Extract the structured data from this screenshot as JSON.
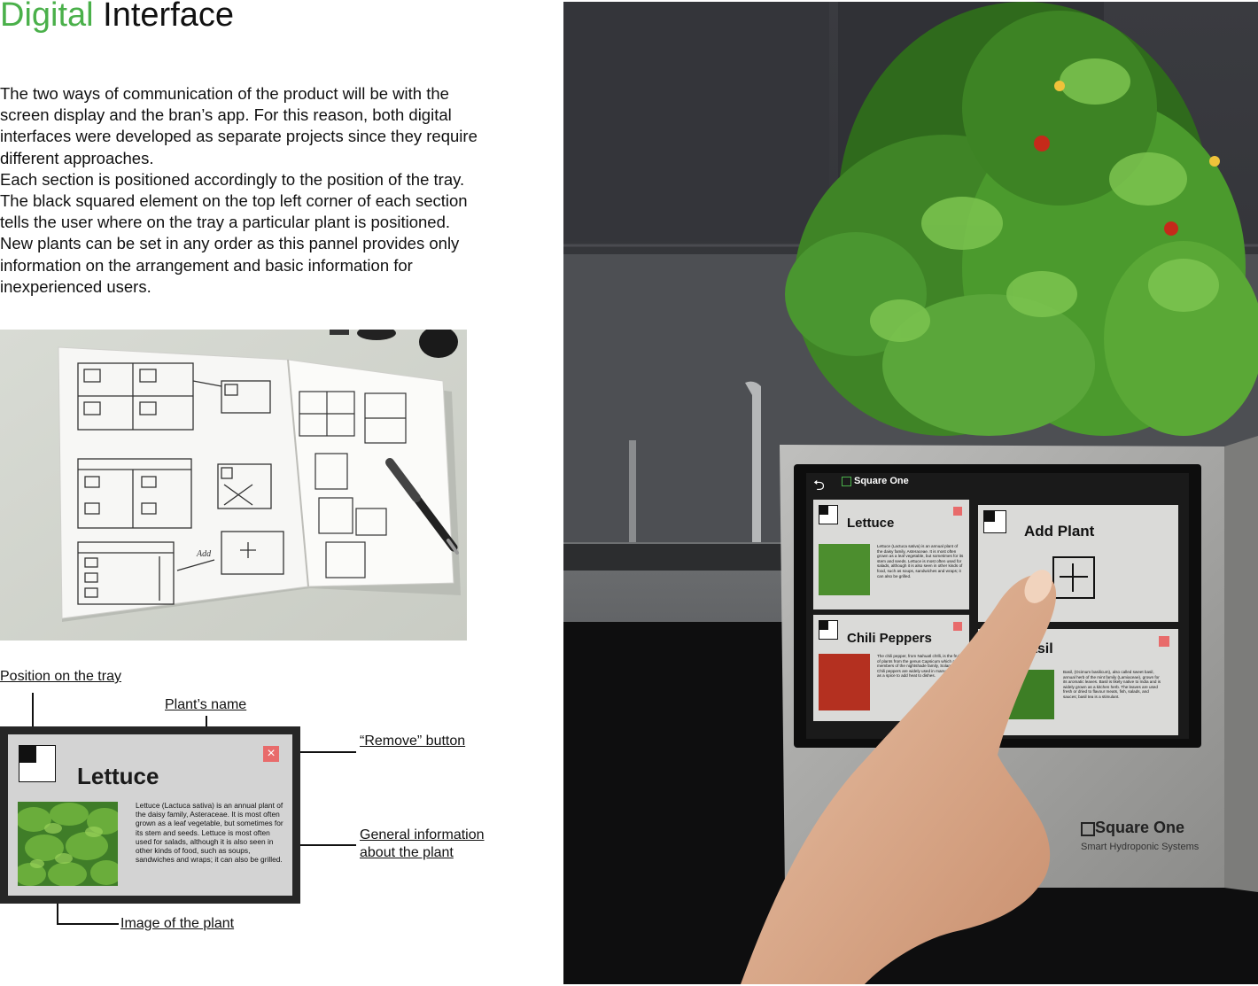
{
  "header": {
    "title_accent": "Digital",
    "title_rest": " Interface"
  },
  "intro": {
    "paragraph_1": "The two ways of communication of the product will be with the screen display and the bran’s app. For this reason, both digital interfaces were developed as separate projects since they require different approaches.",
    "paragraph_2": "Each section is positioned accordingly to the position of the tray. The black squared element on the top left corner of each section tells the user where on the tray a particular plant is positioned. New plants can be set in any order as this pannel provides only information on the arrangement and basic information for inexperienced users."
  },
  "sketch": {
    "handwritten_add": "Add"
  },
  "annotations": {
    "position_on_tray": "Position on the tray ",
    "plant_name": "Plant’s name",
    "remove_button": "“Remove” button",
    "general_info_line1": "General information ",
    "general_info_line2": "about the plant",
    "image_of_plant": "Image of the plant"
  },
  "mock_card": {
    "plant_name": "Lettuce",
    "remove_glyph": "×",
    "info_text": "Lettuce (Lactuca sativa) is an annual plant of the daisy family, Asteraceae. It is most often grown as a leaf vegetable, but sometimes for its stem and seeds. Lettuce is most often used for salads, although it is also seen in other kinds of food, such as soups, sandwiches and wraps; it can also be grilled."
  },
  "device": {
    "back_glyph": "⮌",
    "brand_small": "Square One",
    "tiles": [
      {
        "name": "Lettuce",
        "text": "Lettuce (Lactuca sativa) is an annual plant of the daisy family, Asteraceae. It is most often grown as a leaf vegetable, but sometimes for its stem and seeds. Lettuce is most often used for salads, although it is also seen in other kinds of food, such as soups, sandwiches and wraps; it can also be grilled."
      },
      {
        "name": "Add Plant",
        "text": ""
      },
      {
        "name": "Chili Peppers",
        "text": "The chili pepper, from Nahuatl chīlli, is the fruit of plants from the genus Capsicum which are members of the nightshade family, Solanaceae. Chili peppers are widely used in many cuisines as a spice to add heat to dishes."
      },
      {
        "name": "asil",
        "text": "Basil, (Ocimum basilicum), also called sweet basil, annual herb of the mint family (Lamiaceae), grown for its aromatic leaves. Basil is likely native to India and is widely grown as a kitchen herb. The leaves are used fresh or dried to flavour meats, fish, salads, and sauces; basil tea is a stimulant."
      }
    ],
    "brand_large": "Square One",
    "tagline": "Smart Hydroponic Systems"
  },
  "colors": {
    "accent_green": "#4ab04a",
    "remove_red": "#e86b6b",
    "card_bezel": "#262626",
    "card_screen": "#d3d3d3"
  }
}
